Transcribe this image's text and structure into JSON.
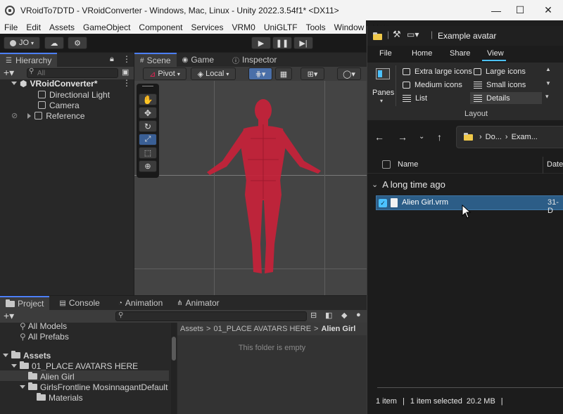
{
  "unity": {
    "title": "VRoidTo7DTD - VRoidConverter - Windows, Mac, Linux - Unity 2022.3.54f1* <DX11>",
    "menu": [
      "File",
      "Edit",
      "Assets",
      "GameObject",
      "Component",
      "Services",
      "VRM0",
      "UniGLTF",
      "Tools",
      "Window",
      "Help"
    ],
    "account": "JO",
    "hierarchy": {
      "tab": "Hierarchy",
      "search_placeholder": "All",
      "scene_name": "VRoidConverter*",
      "items": [
        "Directional Light",
        "Camera",
        "Reference"
      ]
    },
    "scene_tabs": [
      "Scene",
      "Game",
      "Inspector"
    ],
    "scene_toolbar": {
      "pivot": "Pivot",
      "local": "Local"
    },
    "bottom_tabs": [
      "Project",
      "Console",
      "Animation",
      "Animator"
    ],
    "project": {
      "favorites": [
        "All Models",
        "All Prefabs"
      ],
      "assets_label": "Assets",
      "tree": [
        "01_PLACE AVATARS HERE",
        "Alien Girl",
        "GirlsFrontline MosinnagantDefault",
        "Materials"
      ],
      "breadcrumb": [
        "Assets",
        "01_PLACE AVATARS HERE",
        "Alien Girl"
      ],
      "empty_text": "This folder is empty"
    }
  },
  "explorer": {
    "title": "Example avatar",
    "ribbon_tabs": [
      "File",
      "Home",
      "Share",
      "View"
    ],
    "panes_label": "Panes",
    "layout_options": [
      "Extra large icons",
      "Large icons",
      "Medium icons",
      "Small icons",
      "List",
      "Details"
    ],
    "layout_label": "Layout",
    "address": [
      "Do...",
      "Exam..."
    ],
    "columns": [
      "Name",
      "Date"
    ],
    "group": "A long time ago",
    "file": {
      "name": "Alien Girl.vrm",
      "date": "31-D"
    },
    "status": {
      "count": "1 item",
      "selected": "1 item selected",
      "size": "20.2 MB"
    }
  },
  "colors": {
    "accent": "#4c7fff",
    "figure": "#c8223a",
    "selection": "#2c5d87"
  }
}
